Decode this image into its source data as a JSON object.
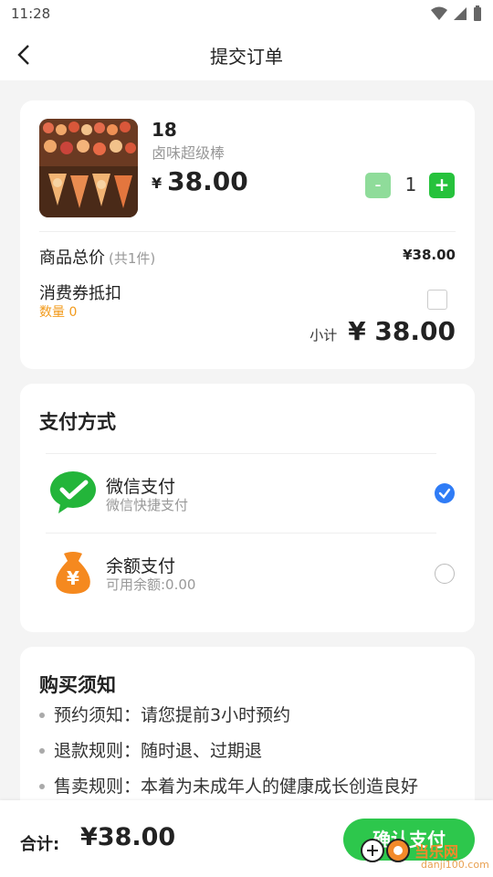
{
  "status_bar": {
    "time": "11:28"
  },
  "header": {
    "title": "提交订单",
    "back_icon": "chevron-left-icon"
  },
  "product": {
    "name": "18",
    "subtitle": "卤味超级棒",
    "price_symbol": "¥",
    "price": "38.00",
    "minus_label": "-",
    "quantity": "1",
    "plus_label": "+"
  },
  "summary": {
    "total_label": "商品总价",
    "total_count": "(共1件)",
    "total_value": "¥38.00",
    "coupon_label": "消费券抵扣",
    "coupon_count": "数量 0",
    "subtotal_label": "小计",
    "subtotal_value": "¥ 38.00"
  },
  "payment": {
    "title": "支付方式",
    "methods": [
      {
        "name": "微信支付",
        "desc": "微信快捷支付",
        "icon": "wechat-pay-icon",
        "selected": true
      },
      {
        "name": "余额支付",
        "desc": "可用余额:0.00",
        "icon": "money-bag-icon",
        "selected": false
      }
    ]
  },
  "notice": {
    "title": "购买须知",
    "items": [
      "预约须知：请您提前3小时预约",
      "退款规则：随时退、过期退",
      "售卖规则：本着为未成年人的健康成长创造良好"
    ]
  },
  "footer": {
    "total_label": "合计:",
    "total_value": "¥38.00",
    "confirm_label": "确认支付"
  },
  "watermark": {
    "text": "当乐网",
    "url": "danji100.com"
  },
  "colors": {
    "accent_green": "#2dc74c",
    "select_blue": "#2f7cf6",
    "coupon_orange": "#f29a1b"
  }
}
